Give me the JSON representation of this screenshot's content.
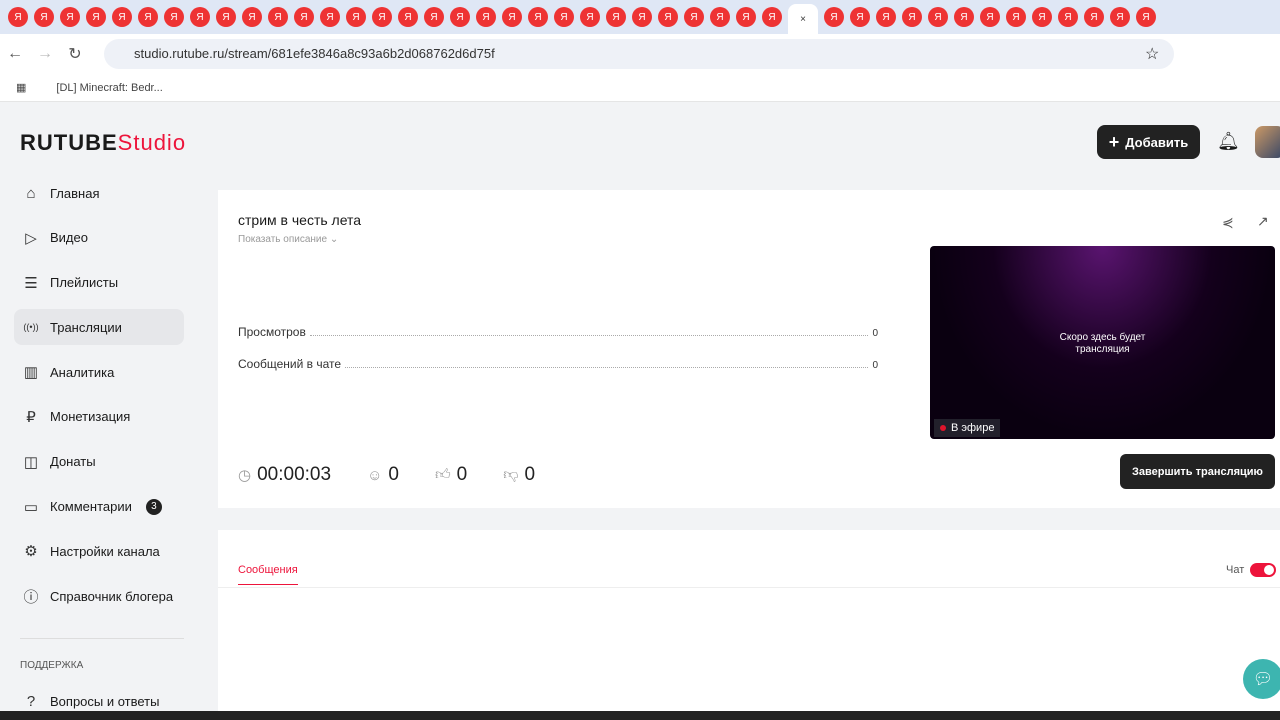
{
  "browser": {
    "url": "studio.rutube.ru/stream/681efe3846a8c93a6b2d068762d6d75f",
    "bookmark": "[DL] Minecraft: Bedr...",
    "tab_count": 44
  },
  "header": {
    "logo_main": "RUTUBE",
    "logo_sub": "Studio",
    "add_button": "Добавить"
  },
  "sidebar": {
    "items": [
      {
        "label": "Главная",
        "icon": "⌂"
      },
      {
        "label": "Видео",
        "icon": "▷"
      },
      {
        "label": "Плейлисты",
        "icon": "☰"
      },
      {
        "label": "Трансляции",
        "icon": "((•))"
      },
      {
        "label": "Аналитика",
        "icon": "▥"
      },
      {
        "label": "Монетизация",
        "icon": "₽"
      },
      {
        "label": "Донаты",
        "icon": "◫"
      },
      {
        "label": "Комментарии",
        "icon": "▭",
        "badge": "3"
      },
      {
        "label": "Настройки канала",
        "icon": "⚙"
      },
      {
        "label": "Справочник блогера",
        "icon": "ⓘ"
      }
    ],
    "support_heading": "Поддержка",
    "support_item": "Вопросы и ответы"
  },
  "stream": {
    "title": "стрим в честь лета",
    "show_description": "Показать описание",
    "stats": [
      {
        "label": "Просмотров",
        "value": "0"
      },
      {
        "label": "Сообщений в чате",
        "value": "0"
      }
    ],
    "timer": "00:00:03",
    "viewers": "0",
    "likes": "0",
    "dislikes": "0",
    "player_text_1": "Скоро здесь будет",
    "player_text_2": "трансляция",
    "live_label": "В эфире",
    "end_button": "Завершить трансляцию"
  },
  "chat": {
    "tab": "Сообщения",
    "chat_label": "Чат",
    "chat_enabled": true
  }
}
